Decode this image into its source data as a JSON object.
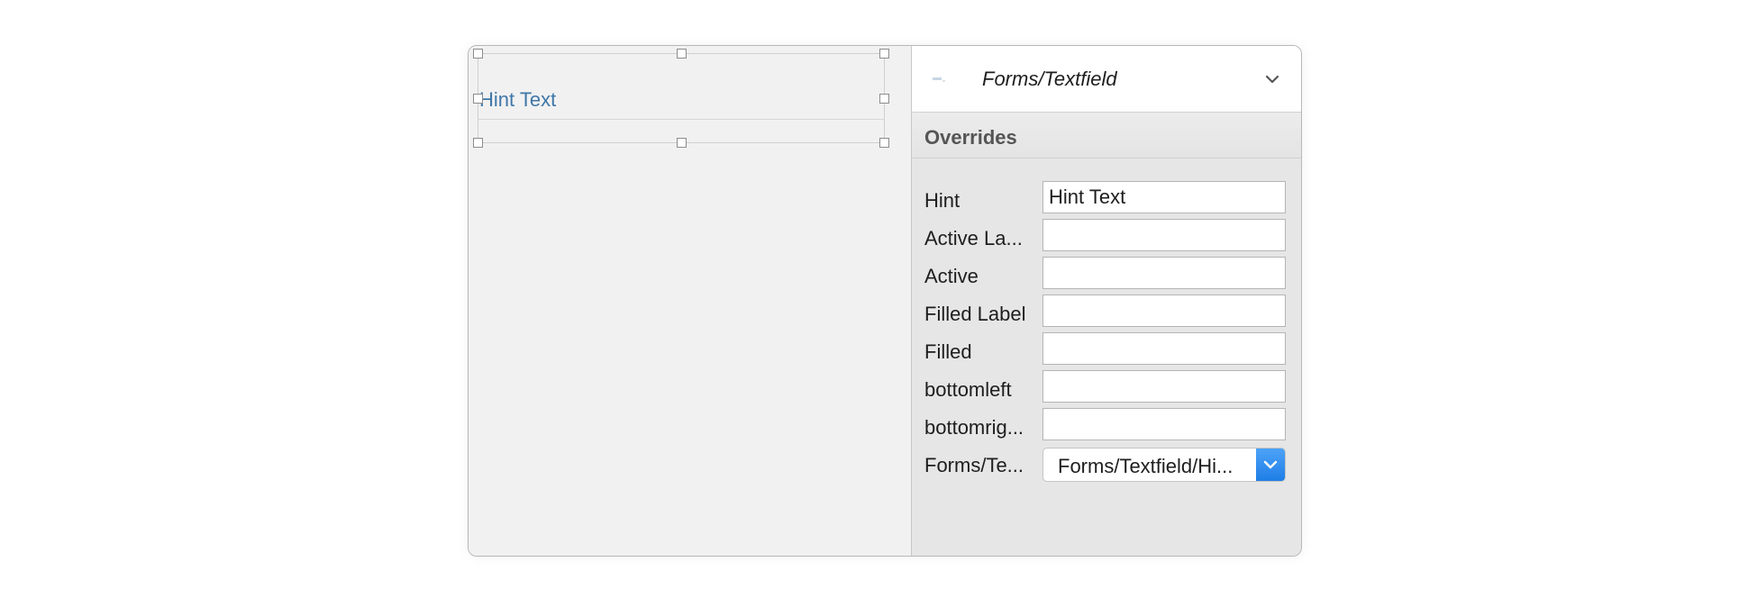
{
  "canvas": {
    "hint_preview": "Hint Text"
  },
  "inspector": {
    "symbol_name": "Forms/Textfield",
    "symbol_icon": "symbol-thumbnail-icon",
    "chevron_icon": "chevron-down-icon",
    "overrides_title": "Overrides",
    "rows": [
      {
        "label": "Hint",
        "value": "Hint Text"
      },
      {
        "label": "Active La...",
        "value": ""
      },
      {
        "label": "Active",
        "value": ""
      },
      {
        "label": "Filled Label",
        "value": ""
      },
      {
        "label": "Filled",
        "value": ""
      },
      {
        "label": "bottomleft",
        "value": ""
      },
      {
        "label": "bottomrig...",
        "value": ""
      }
    ],
    "select_row": {
      "label": "Forms/Te...",
      "value": "Forms/Textfield/Hi..."
    }
  },
  "colors": {
    "hint_preview": "#3f77a8",
    "select_accent": "#2b8ef0"
  }
}
